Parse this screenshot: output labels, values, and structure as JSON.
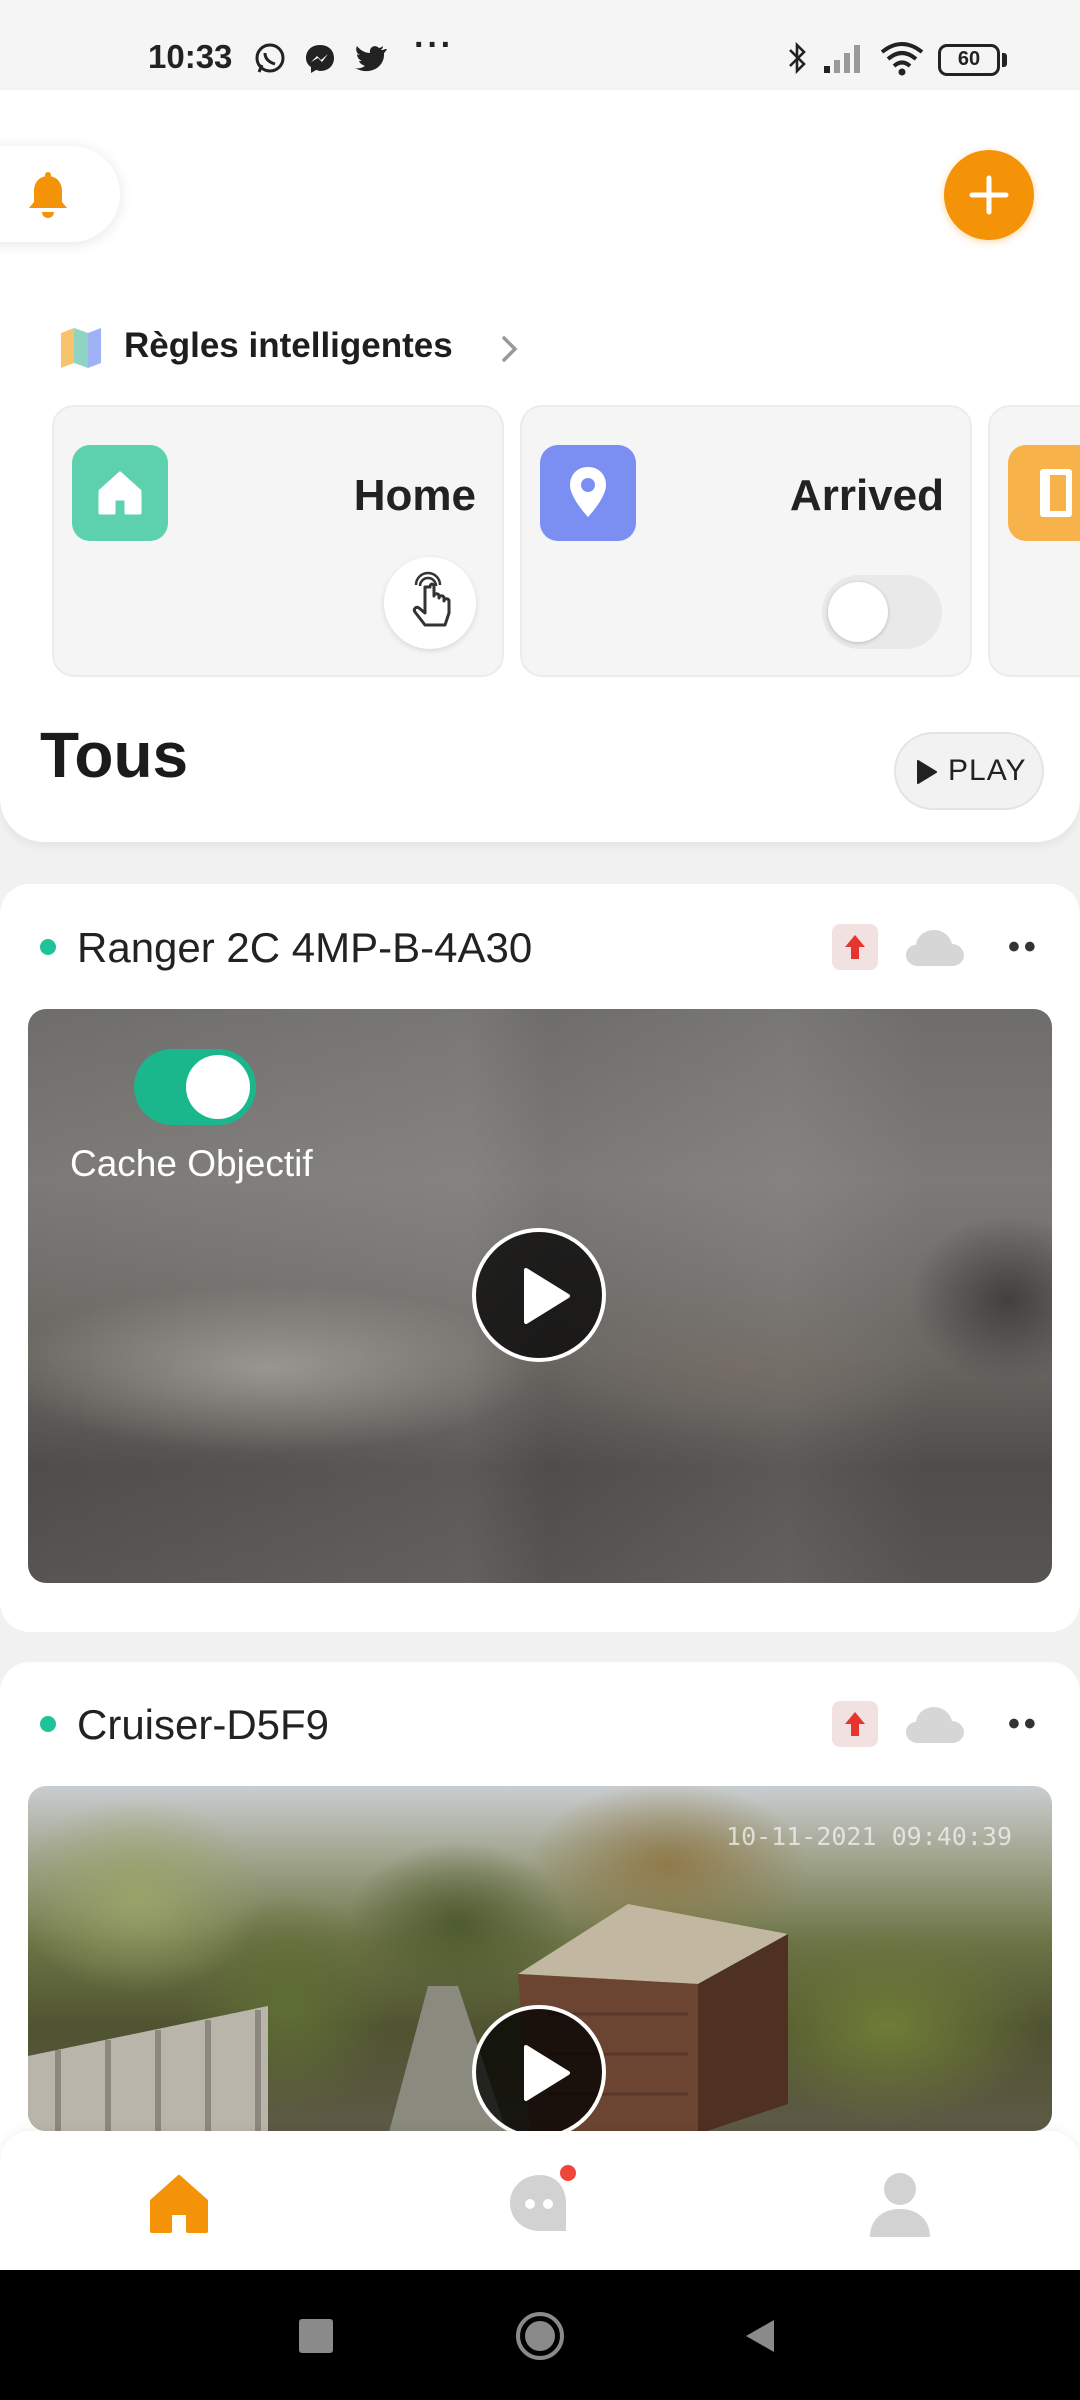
{
  "status_bar": {
    "time": "10:33",
    "app_icons": [
      "whatsapp-icon",
      "messenger-icon",
      "twitter-icon"
    ],
    "more": "···",
    "battery": "60",
    "system_icons": [
      "bluetooth-icon",
      "signal-icon",
      "wifi-icon",
      "battery-icon"
    ]
  },
  "header": {
    "notifications_icon": "bell-icon",
    "add_icon": "plus-icon",
    "accent_color": "#f49308"
  },
  "smart_rules": {
    "title": "Règles intelligentes",
    "scenes": [
      {
        "name": "Home",
        "icon": "home-icon",
        "icon_color": "#5dd1ae",
        "control": "tap-to-run"
      },
      {
        "name": "Arrived",
        "icon": "location-pin-icon",
        "icon_color": "#7b8ff2",
        "control": "toggle",
        "enabled": false
      },
      {
        "name": "",
        "icon": "door-icon",
        "icon_color": "#f7b24a"
      }
    ]
  },
  "devices_section": {
    "title": "Tous",
    "play_label": "PLAY"
  },
  "devices": [
    {
      "name": "Ranger 2C 4MP-B-4A30",
      "online": true,
      "privacy_toggle_label": "Cache Objectif",
      "privacy_toggle_on": true,
      "more": "••"
    },
    {
      "name": "Cruiser-D5F9",
      "online": true,
      "timestamp": "10-11-2021 09:40:39",
      "more": "••"
    }
  ],
  "bottom_nav": {
    "items": [
      {
        "name": "home",
        "icon": "home-icon",
        "active": true
      },
      {
        "name": "messages",
        "icon": "chat-icon",
        "badge": true
      },
      {
        "name": "profile",
        "icon": "user-icon"
      }
    ]
  }
}
